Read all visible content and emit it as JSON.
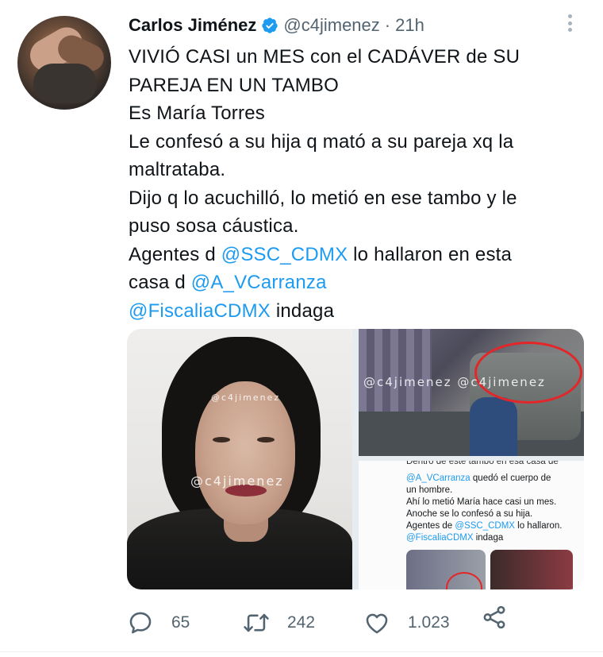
{
  "author": {
    "name": "Carlos Jiménez",
    "handle": "@c4jimenez",
    "separator": "·",
    "time": "21h"
  },
  "tweet": {
    "lines": [
      "VIVIÓ CASI un MES con el CADÁVER de SU",
      "PAREJA EN UN TAMBO",
      "Es María Torres",
      "Le confesó a su hija q mató a su pareja xq la",
      "maltrataba.",
      "Dijo q lo acuchilló, lo metió en ese tambo y le",
      "puso sosa cáustica."
    ],
    "line8_prefix": "Agentes d ",
    "line8_mention": "@SSC_CDMX",
    "line8_suffix": " lo hallaron en esta",
    "line9_prefix": "casa d ",
    "line9_mention": "@A_VCarranza",
    "line10_mention": "@FiscaliaCDMX",
    "line10_suffix": " indaga"
  },
  "media": {
    "watermark_small": "@c4jimenez",
    "watermark_main": "@c4jimenez",
    "watermark_top_right": "@c4jimenez @c4jimenez",
    "screenshot_text": {
      "cut_line": "Dentro de este tambo en esa casa de",
      "mention1": "@A_VCarranza",
      "line1_suffix": " quedó el cuerpo de",
      "line2": "un hombre.",
      "line3": "Ahí lo metió María hace casi un mes.",
      "line4": "Anoche se lo confesó a su hija.",
      "line5_prefix": "Agentes de ",
      "mention2": "@SSC_CDMX",
      "line5_suffix": " lo hallaron.",
      "mention3": "@FiscaliaCDMX",
      "line6_suffix": " indaga"
    }
  },
  "actions": {
    "reply_count": "65",
    "retweet_count": "242",
    "like_count": "1.023",
    "icons": [
      "reply-icon",
      "retweet-icon",
      "like-icon",
      "share-icon"
    ]
  },
  "colors": {
    "link": "#1d9bf0",
    "secondary_text": "#536471",
    "verified": "#1d9bf0"
  }
}
